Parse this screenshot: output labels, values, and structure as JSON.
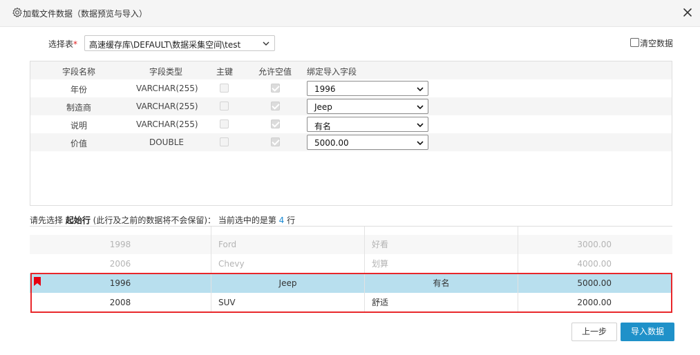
{
  "dialog": {
    "title": "加载文件数据（数据预览与导入）",
    "icon": "gear-icon",
    "close_icon": "close-icon"
  },
  "select_table": {
    "label": "选择表",
    "required_mark": "*",
    "value": "高速缓存库\\DEFAULT\\数据采集空间\\test"
  },
  "clear_data": {
    "label": "清空数据",
    "checked": false
  },
  "fields": {
    "headers": [
      "字段名称",
      "字段类型",
      "主键",
      "允许空值",
      "绑定导入字段"
    ],
    "rows": [
      {
        "name": "年份",
        "type": "VARCHAR(255)",
        "primary_key": false,
        "nullable": true,
        "bind": "1996"
      },
      {
        "name": "制造商",
        "type": "VARCHAR(255)",
        "primary_key": false,
        "nullable": true,
        "bind": "Jeep"
      },
      {
        "name": "说明",
        "type": "VARCHAR(255)",
        "primary_key": false,
        "nullable": true,
        "bind": "有名"
      },
      {
        "name": "价值",
        "type": "DOUBLE",
        "primary_key": false,
        "nullable": true,
        "bind": "5000.00"
      }
    ]
  },
  "hint": {
    "prefix": "请先选择 ",
    "bold": "起始行",
    "middle": " (此行及之前的数据将不会保留)：  当前选中的是第 ",
    "row_number": "4",
    "suffix": " 行"
  },
  "preview": {
    "rows": [
      {
        "year": "1998",
        "maker": "Ford",
        "desc": "好看",
        "value": "3000.00",
        "state": "faded"
      },
      {
        "year": "2006",
        "maker": "Chevy",
        "desc": "划算",
        "value": "4000.00",
        "state": "faded"
      },
      {
        "year": "1996",
        "maker": "Jeep",
        "desc": "有名",
        "value": "5000.00",
        "state": "selected"
      },
      {
        "year": "2008",
        "maker": "SUV",
        "desc": "舒适",
        "value": "2000.00",
        "state": "active"
      }
    ]
  },
  "buttons": {
    "prev": "上一步",
    "import": "导入数据"
  },
  "colors": {
    "accent": "#1f91c9",
    "selected_row": "#b8dfee",
    "highlight_border": "#e8262a",
    "hint_number": "#1b8ad3",
    "flag": "#e60012"
  }
}
